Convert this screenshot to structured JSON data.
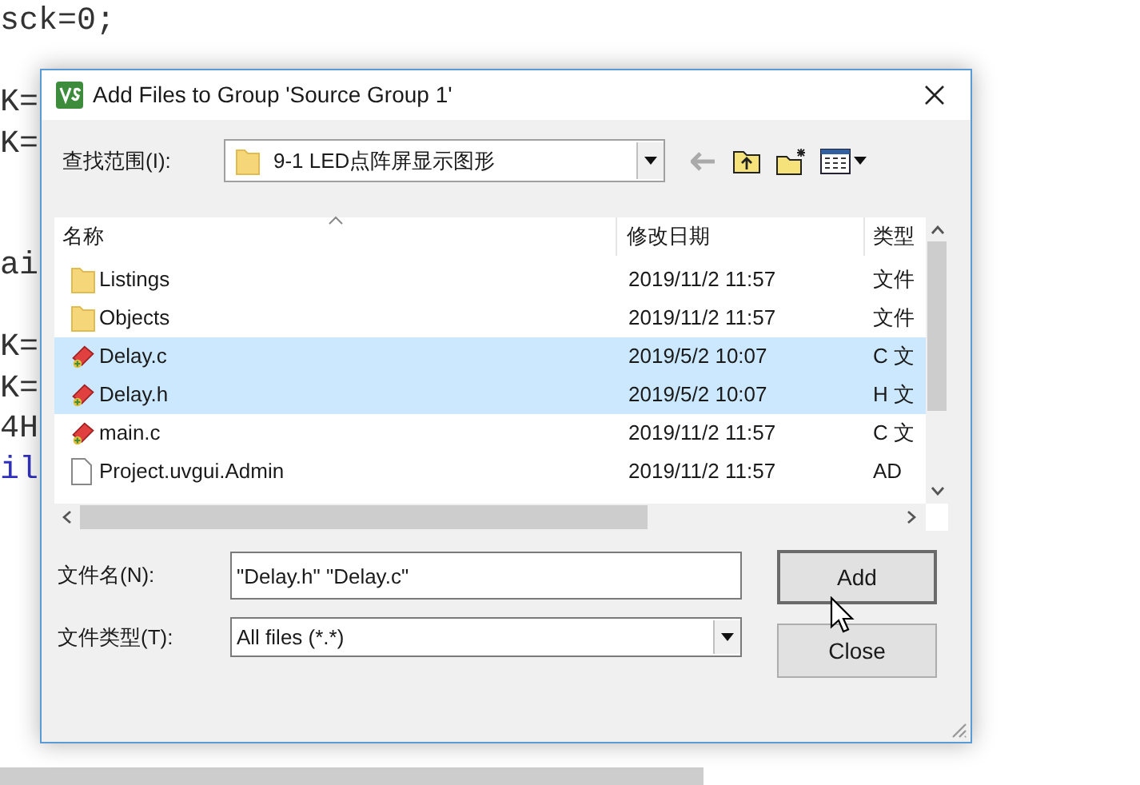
{
  "background_code": {
    "lines": [
      {
        "kind": "code",
        "text": "sck=0;",
        "color": "#333333"
      },
      {
        "kind": "blank"
      },
      {
        "kind": "code",
        "text": "K=",
        "color": "#333333"
      },
      {
        "kind": "code",
        "text": "K=",
        "color": "#333333"
      },
      {
        "kind": "blank"
      },
      {
        "kind": "blank"
      },
      {
        "kind": "code",
        "text": "ai",
        "color": "#333333"
      },
      {
        "kind": "blank"
      },
      {
        "kind": "code",
        "text": "K=",
        "color": "#333333"
      },
      {
        "kind": "code",
        "text": "K=",
        "color": "#333333"
      },
      {
        "kind": "code",
        "text": "4H",
        "color": "#333333"
      },
      {
        "kind": "code",
        "text": "il",
        "color": "#3030c0"
      }
    ]
  },
  "dialog": {
    "title": "Add Files to Group 'Source Group 1'",
    "look_in": {
      "label": "查找范围(I):",
      "value": "9-1 LED点阵屏显示图形"
    },
    "file_list": {
      "columns": [
        "名称",
        "修改日期",
        "类型"
      ],
      "rows": [
        {
          "kind": "folder",
          "name": "Listings",
          "date": "2019/11/2 11:57",
          "type": "文件",
          "selected": false
        },
        {
          "kind": "folder",
          "name": "Objects",
          "date": "2019/11/2 11:57",
          "type": "文件",
          "selected": false
        },
        {
          "kind": "source",
          "name": "Delay.c",
          "date": "2019/5/2 10:07",
          "type": "C 文",
          "selected": true
        },
        {
          "kind": "source",
          "name": "Delay.h",
          "date": "2019/5/2 10:07",
          "type": "H 文",
          "selected": true
        },
        {
          "kind": "source",
          "name": "main.c",
          "date": "2019/11/2 11:57",
          "type": "C 文",
          "selected": false
        },
        {
          "kind": "file",
          "name": "Project.uvgui.Admin",
          "date": "2019/11/2 11:57",
          "type": "AD",
          "selected": false
        }
      ]
    },
    "file_name": {
      "label": "文件名(N):",
      "value": "\"Delay.h\" \"Delay.c\""
    },
    "file_type": {
      "label": "文件类型(T):",
      "value": "All files (*.*)"
    },
    "buttons": [
      {
        "label": "Add",
        "default": true
      },
      {
        "label": "Close",
        "default": false
      }
    ]
  }
}
